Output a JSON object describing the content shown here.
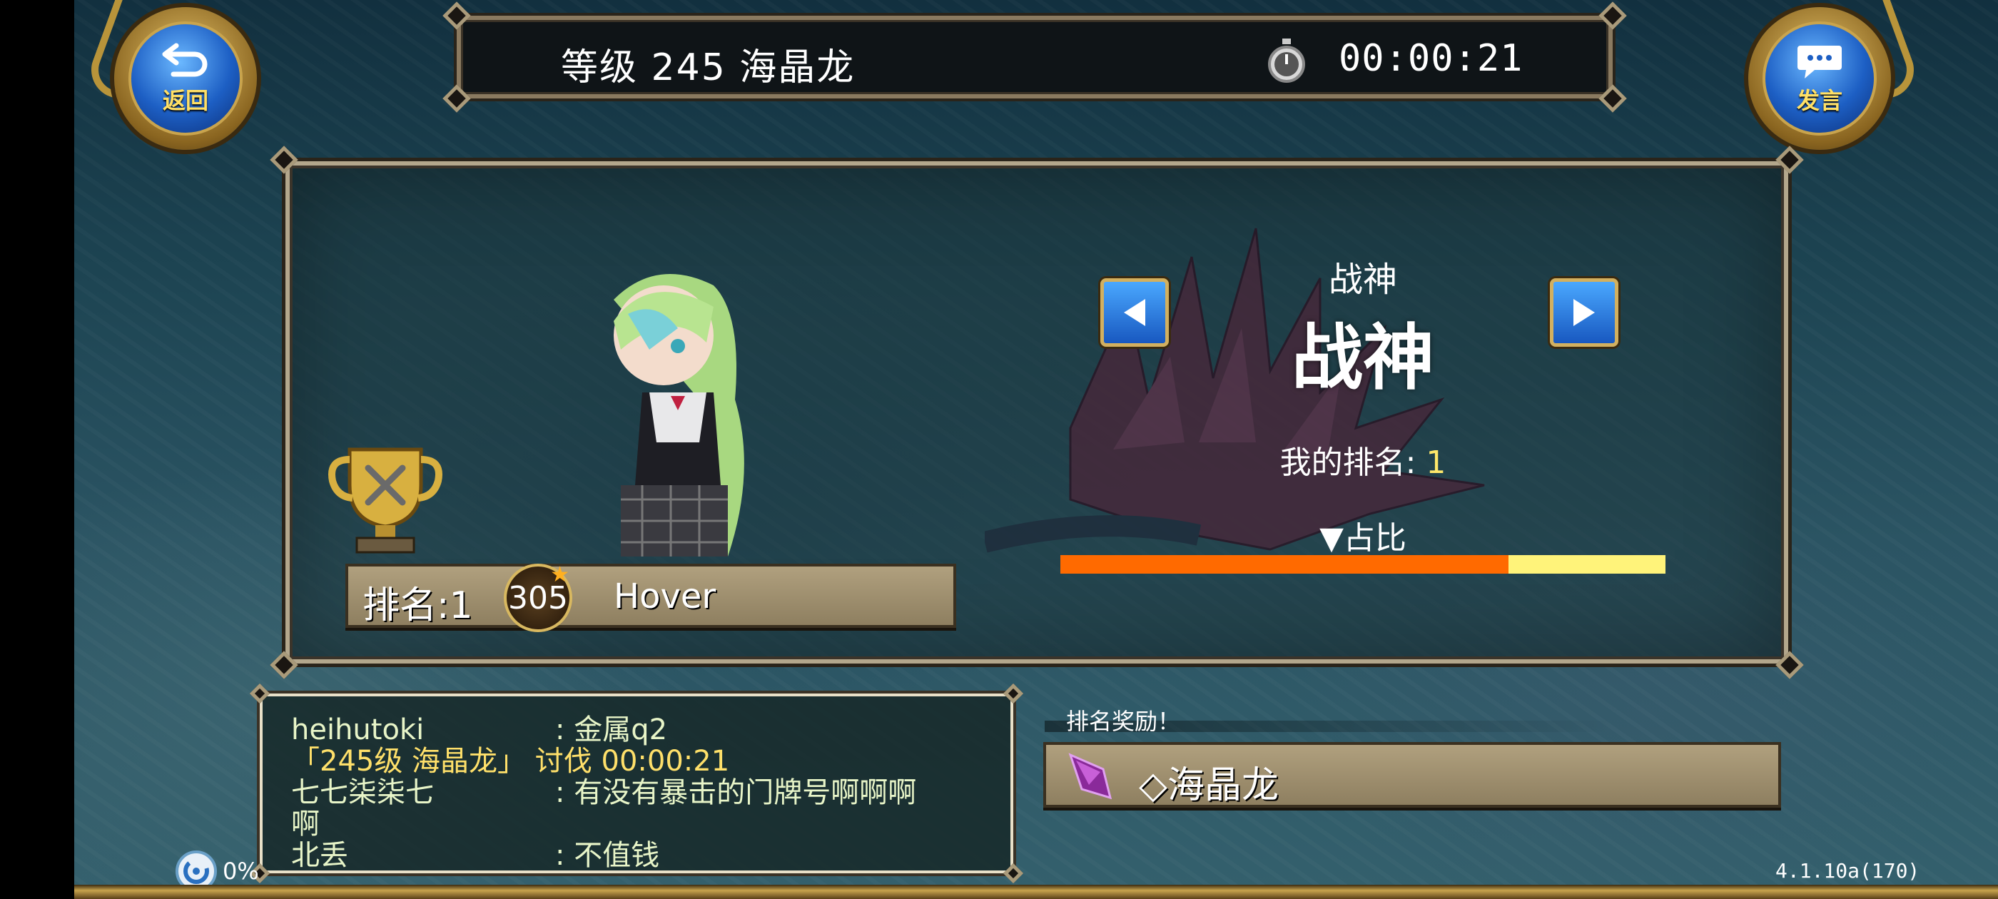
{
  "top_bar": {
    "title": "等级 245 海晶龙",
    "timer": "00:00:21"
  },
  "buttons": {
    "back_label": "返回",
    "chat_label": "发言"
  },
  "ranking": {
    "player_rank": "排名:1",
    "player_level": "305",
    "player_name": "Hover",
    "title_small": "战神",
    "title_big": "战神",
    "my_rank_label": "我的排名:",
    "my_rank_value": "1",
    "share_label": "▼占比",
    "share_fraction": 0.74
  },
  "chat": {
    "lines": [
      {
        "name": "heihutoki",
        "sep": ":",
        "text": "金属q2"
      },
      {
        "system": "「245级 海晶龙」 讨伐 00:00:21"
      },
      {
        "name": "七七柒柒七",
        "sep": ":",
        "text": "有没有暴击的门牌号啊啊啊"
      },
      {
        "continuation": "啊"
      },
      {
        "name": "北丢",
        "sep": ":",
        "text": "不值钱"
      }
    ]
  },
  "reward": {
    "title": "排名奖励！",
    "item_name": "◇海晶龙"
  },
  "status": {
    "loading_percent": "0%",
    "version": "4.1.10a(170)"
  },
  "colors": {
    "share_fill": "#ff6a00",
    "share_rest": "#fff37a",
    "rank_value": "#ffe86a",
    "button_blue": "#1d5fc4",
    "gold_frame": "#c9a44d"
  },
  "icons": [
    "back-arrow-icon",
    "chat-bubble-icon",
    "stopwatch-icon",
    "trophy-icon",
    "star-icon",
    "left-arrow-icon",
    "right-arrow-icon",
    "crystal-icon",
    "loading-icon"
  ]
}
